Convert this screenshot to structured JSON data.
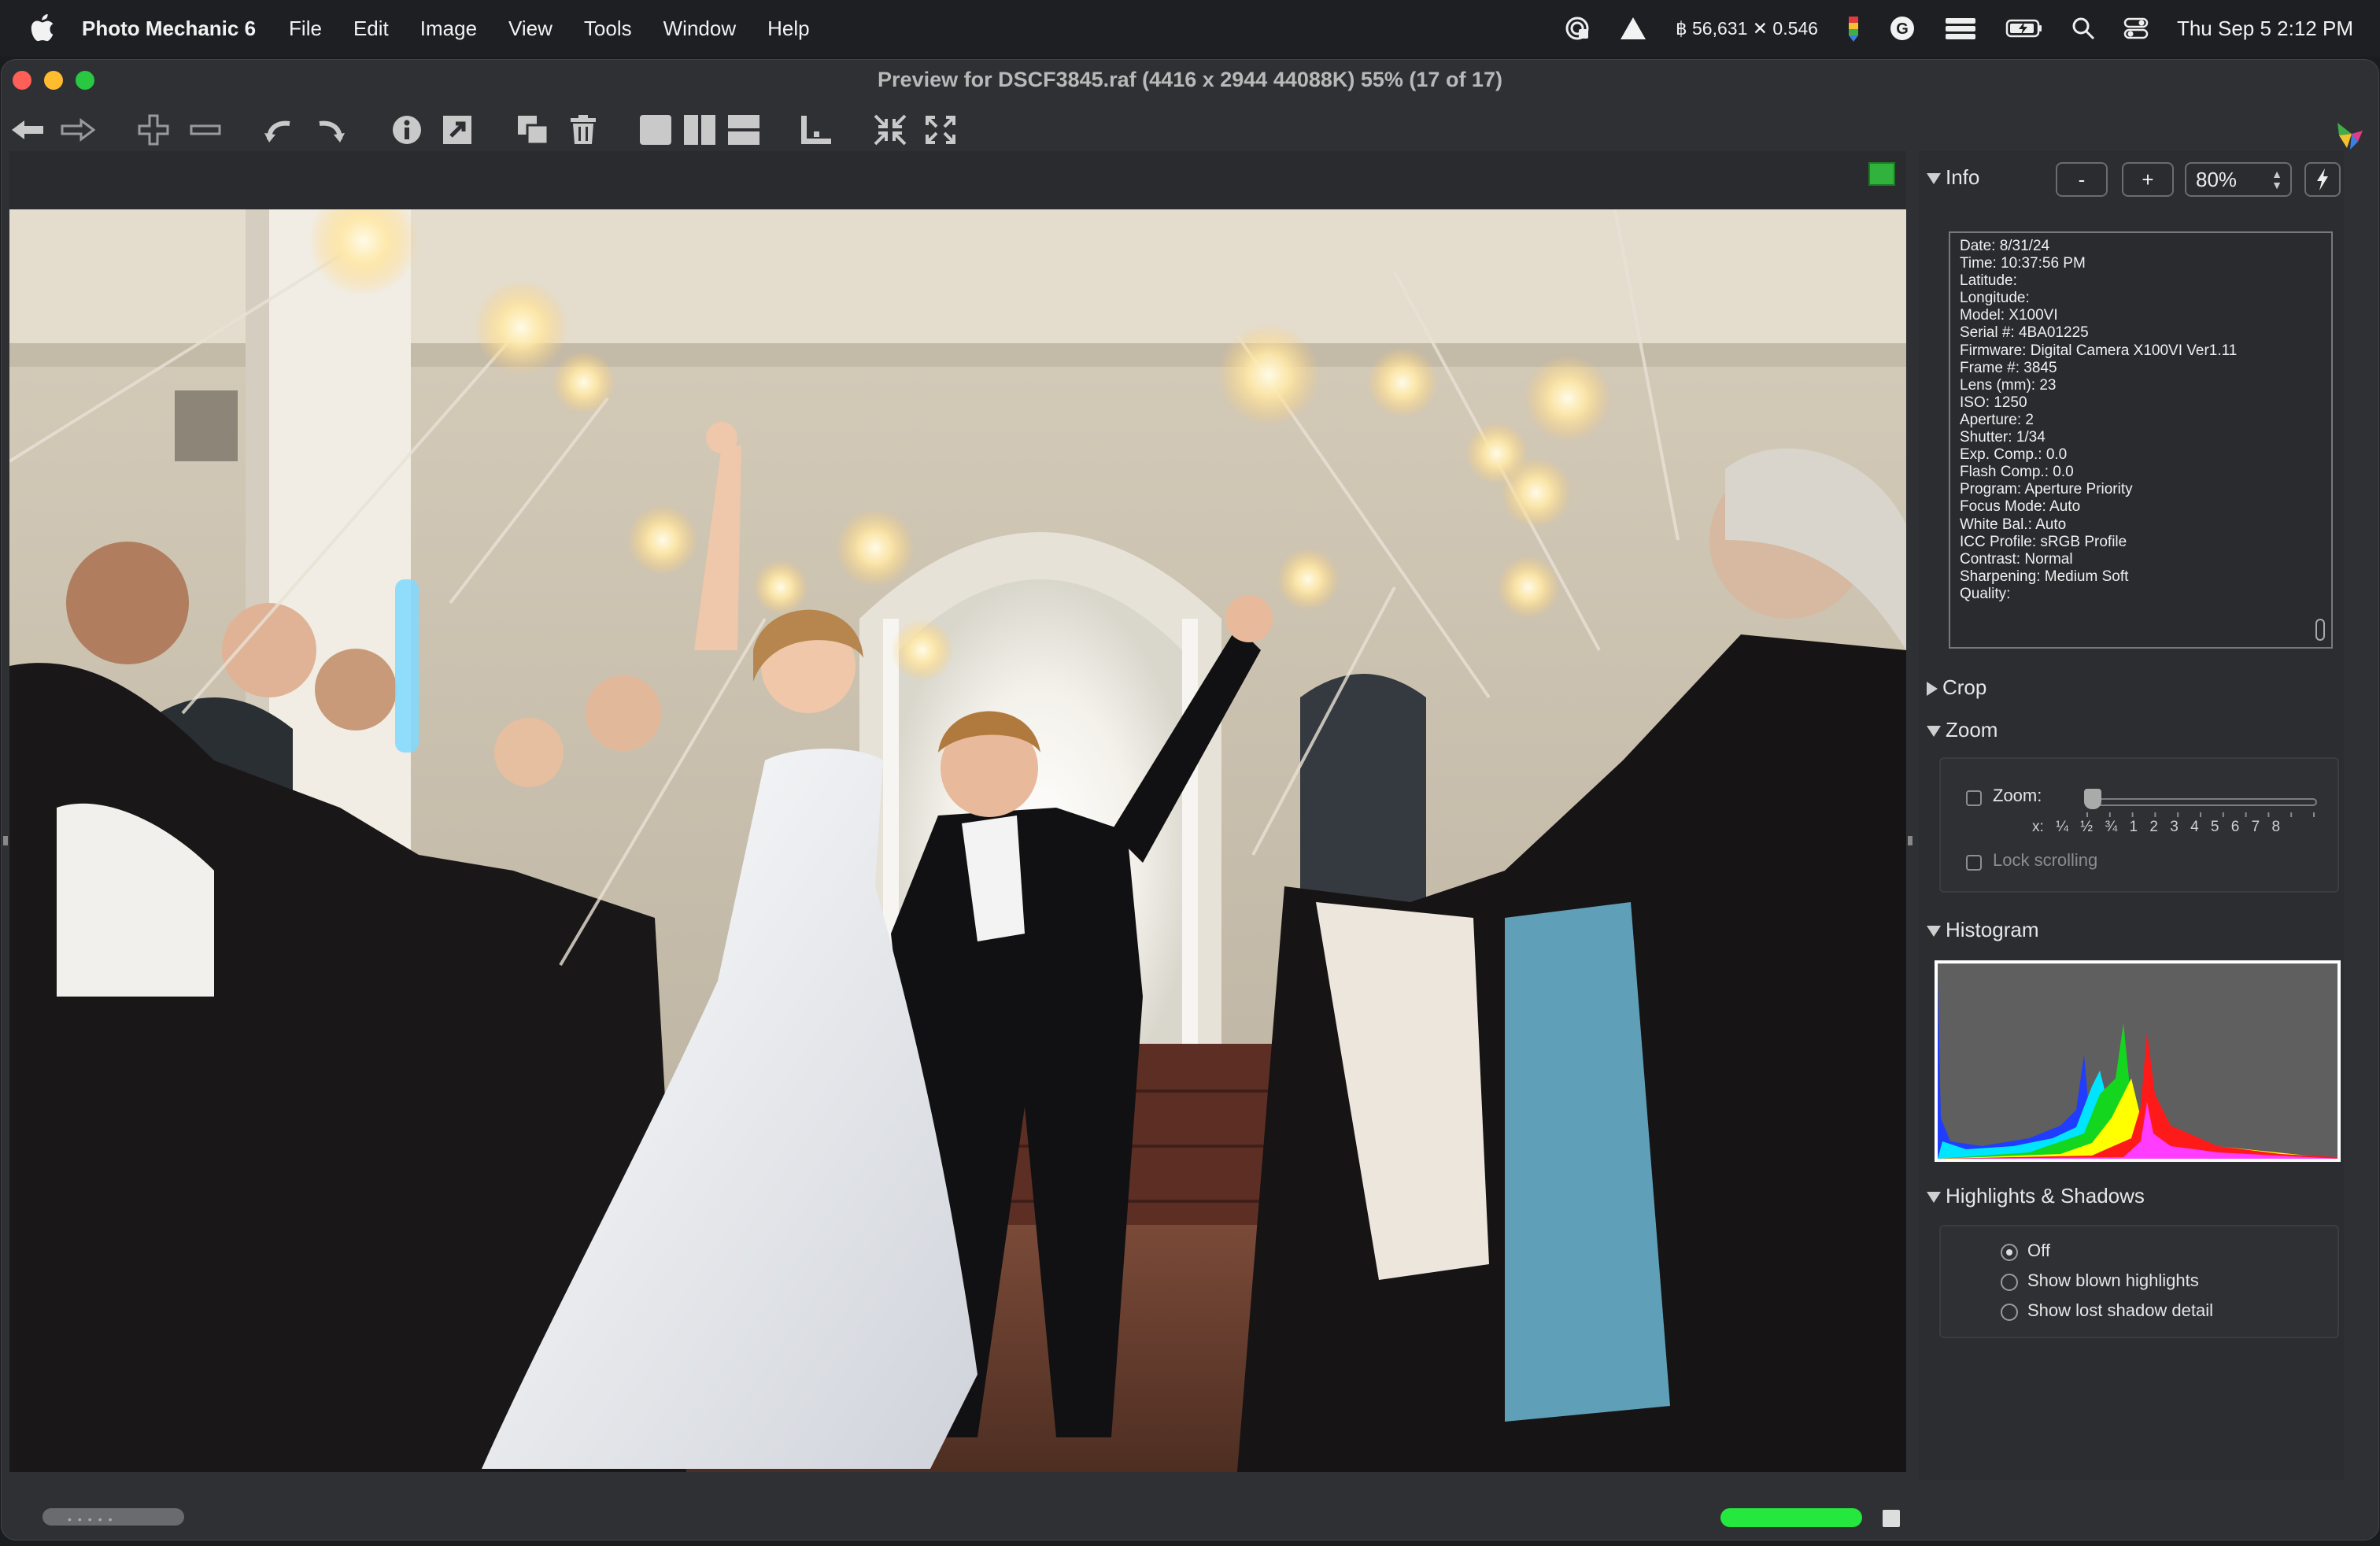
{
  "menubar": {
    "app_name": "Photo Mechanic 6",
    "items": [
      "File",
      "Edit",
      "Image",
      "View",
      "Tools",
      "Window",
      "Help"
    ],
    "crypto": "฿ 56,631 ✕ 0.546",
    "clock": "Thu Sep 5  2:12 PM"
  },
  "window": {
    "title": "Preview for DSCF3845.raf (4416 x 2944 44088K) 55% (17 of 17)"
  },
  "panel": {
    "info": {
      "title": "Info",
      "minus": "-",
      "plus": "+",
      "zoom_value": "80%",
      "lines": [
        "Date: 8/31/24",
        "Time: 10:37:56 PM",
        "Latitude:",
        "Longitude:",
        "Model: X100VI",
        "Serial #: 4BA01225",
        "Firmware: Digital Camera X100VI Ver1.11",
        "Frame #: 3845",
        "Lens (mm): 23",
        "ISO: 1250",
        "Aperture: 2",
        "Shutter: 1/34",
        "Exp. Comp.: 0.0",
        "Flash Comp.: 0.0",
        "Program: Aperture Priority",
        "Focus Mode: Auto",
        "White Bal.: Auto",
        "ICC Profile: sRGB Profile",
        "Contrast: Normal",
        "Sharpening: Medium Soft",
        "Quality:"
      ]
    },
    "crop": {
      "title": "Crop"
    },
    "zoom": {
      "title": "Zoom",
      "label": "Zoom:",
      "scale_prefix": "x:",
      "scale": [
        "¼",
        "½",
        "¾",
        "1",
        "2",
        "3",
        "4",
        "5",
        "6",
        "7",
        "8"
      ],
      "lock_label": "Lock scrolling"
    },
    "histogram": {
      "title": "Histogram"
    },
    "highlights": {
      "title": "Highlights & Shadows",
      "options": [
        "Off",
        "Show blown highlights",
        "Show lost shadow detail"
      ],
      "selected": "Off"
    }
  },
  "colors": {
    "color_tag": "#31b23c",
    "progress": "#24e83e"
  }
}
